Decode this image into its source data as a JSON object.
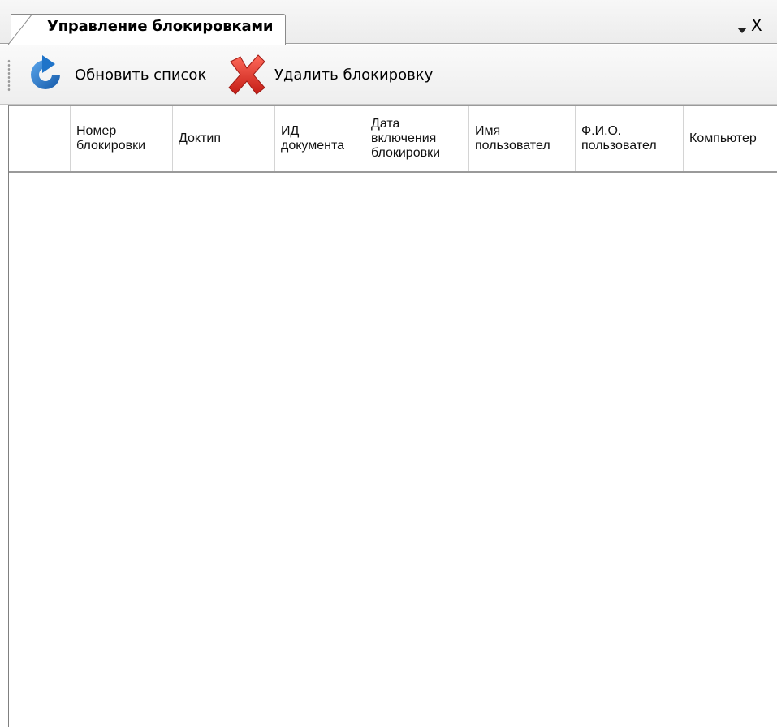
{
  "tab": {
    "title": "Управление блокировками"
  },
  "tab_controls": {
    "close_glyph": "X"
  },
  "toolbar": {
    "refresh_label": "Обновить список",
    "delete_label": "Удалить блокировку"
  },
  "grid": {
    "columns": [
      "Номер\nблокировки",
      "Доктип",
      "ИД\nдокумента",
      "Дата\nвключения\nблокировки",
      "Имя\nпользовател",
      "Ф.И.О.\nпользовател",
      "Компьютер"
    ],
    "rows": []
  },
  "colors": {
    "refresh_icon": "#1f74c9",
    "delete_icon": "#e0302a"
  }
}
